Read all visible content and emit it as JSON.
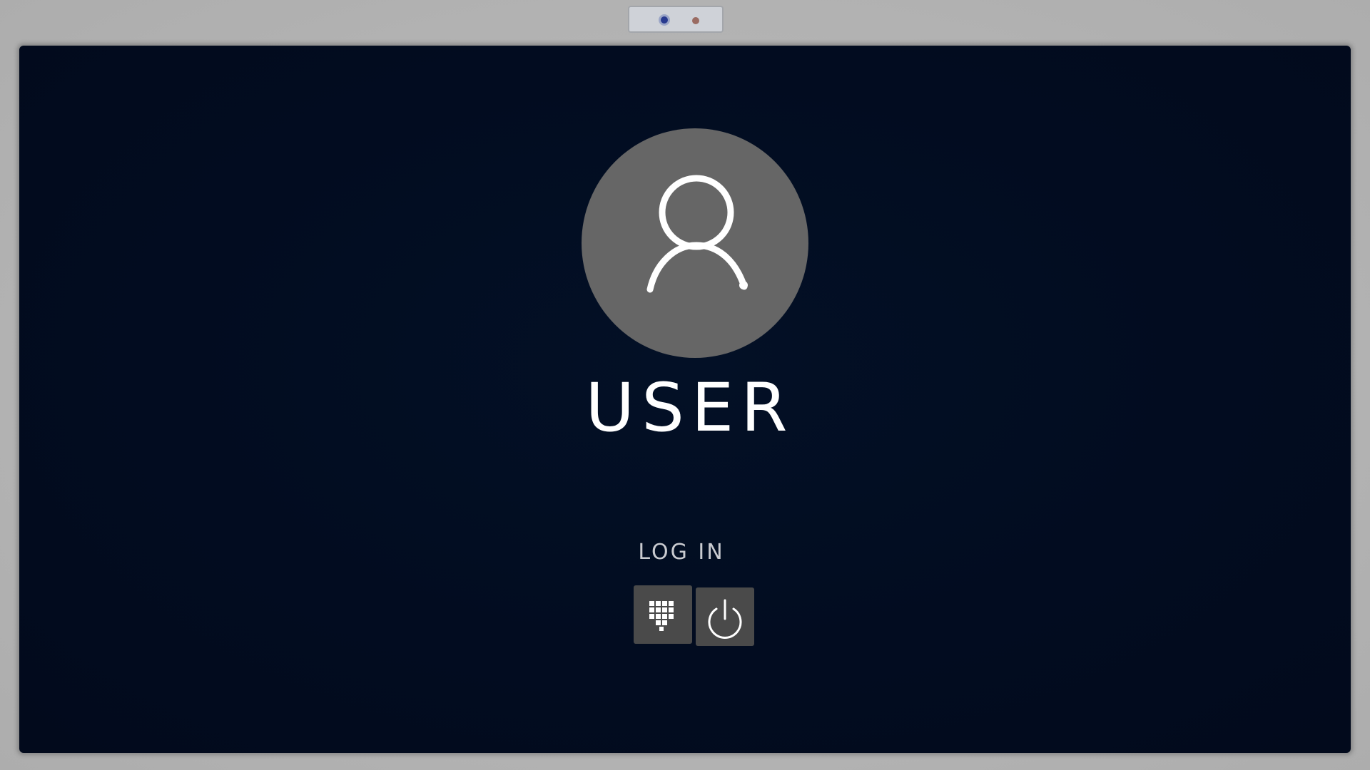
{
  "user": {
    "name": "USER",
    "avatar_icon": "user-silhouette-icon"
  },
  "login": {
    "label": "LOG IN",
    "actions": [
      {
        "name": "keypad",
        "icon": "keypad-icon"
      },
      {
        "name": "power",
        "icon": "power-icon"
      }
    ]
  },
  "colors": {
    "screen_background": "#020c20",
    "avatar_circle": "#666666",
    "button_background": "#4a4a4a",
    "text": "#ffffff",
    "bezel": "#b4b4b4"
  }
}
